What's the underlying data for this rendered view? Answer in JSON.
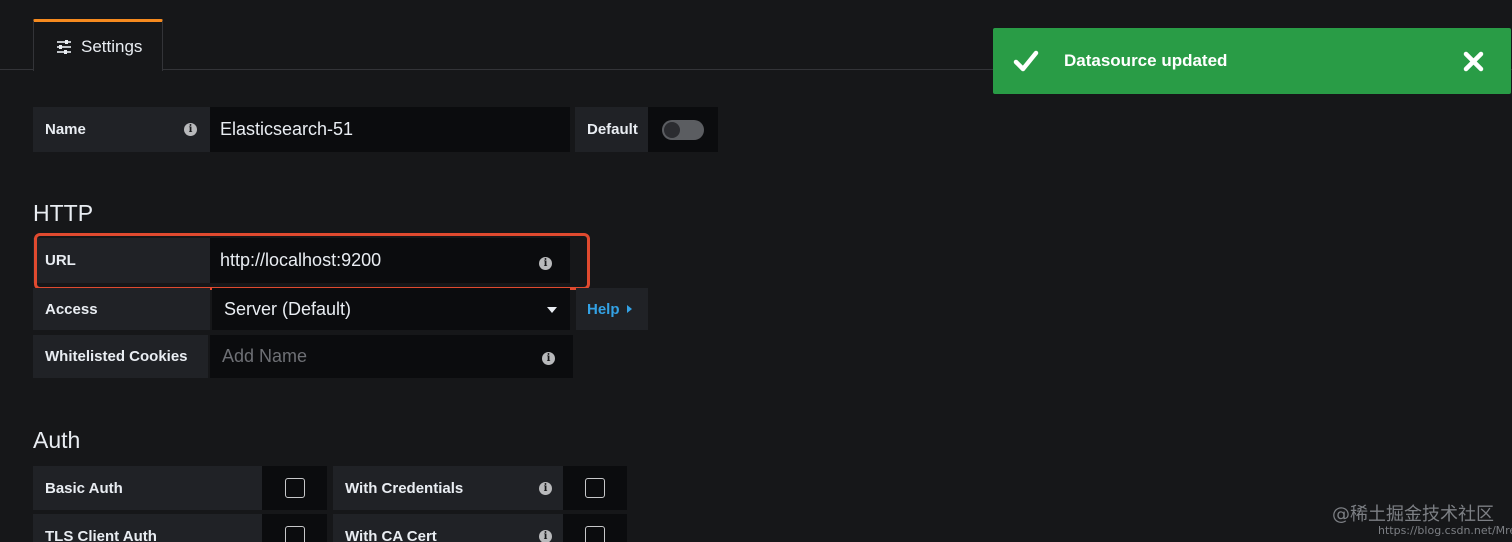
{
  "tabs": [
    {
      "label": "Settings",
      "icon": "sliders-icon",
      "active": true
    }
  ],
  "form": {
    "name": {
      "label": "Name",
      "value": "Elasticsearch-51"
    },
    "default": {
      "label": "Default",
      "enabled": false
    }
  },
  "http": {
    "section_title": "HTTP",
    "url": {
      "label": "URL",
      "value": "http://localhost:9200"
    },
    "access": {
      "label": "Access",
      "value": "Server (Default)",
      "help_label": "Help"
    },
    "cookies": {
      "label": "Whitelisted Cookies",
      "placeholder": "Add Name"
    }
  },
  "auth": {
    "section_title": "Auth",
    "basic_auth": {
      "label": "Basic Auth",
      "checked": false
    },
    "with_credentials": {
      "label": "With Credentials",
      "checked": false
    },
    "tls_client_auth": {
      "label": "TLS Client Auth",
      "checked": false
    },
    "with_ca_cert": {
      "label": "With CA Cert",
      "checked": false
    }
  },
  "toast": {
    "message": "Datasource updated",
    "status_color": "#299c46",
    "icon": "check-icon"
  },
  "colors": {
    "tab_accent": "#f58a1f",
    "highlight": "#e04a2f",
    "link": "#33a2e5"
  },
  "watermark": {
    "text": "@稀土掘金技术社区",
    "url": "https://blog.csdn.net/Mrerlou"
  }
}
